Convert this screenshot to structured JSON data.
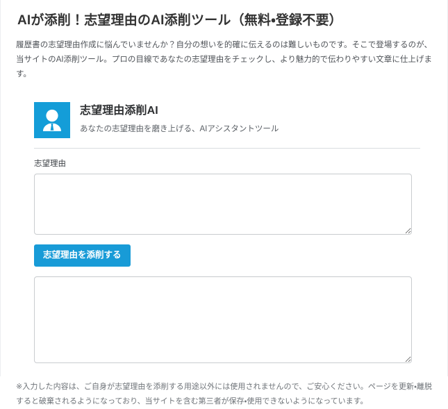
{
  "page": {
    "title": "AIが添削！志望理由のAI添削ツール（無料・登録不要）",
    "lead": "履歴書の志望理由作成に悩んでいませんか？自分の想いを的確に伝えるのは難しいものです。そこで登場するのが、当サイトのAI添削ツール。プロの目線であなたの志望理由をチェックし、より魅力的で伝わりやすい文章に仕上げます。"
  },
  "card": {
    "icon": "person-avatar-icon",
    "title": "志望理由添削AI",
    "subtitle": "あなたの志望理由を磨き上げる、AIアシスタントツール"
  },
  "form": {
    "input_label": "志望理由",
    "input_value": "",
    "input_placeholder": "",
    "submit_label": "志望理由を添削する",
    "output_value": "",
    "output_placeholder": ""
  },
  "footer": {
    "note": "※入力した内容は、ご自身が志望理由を添削する用途以外には使用されませんので、ご安心ください。ページを更新・離脱すると破棄されるようになっており、当サイトを含む第三者が保存・使用できないようになっています。"
  },
  "colors": {
    "accent": "#149dd8",
    "button": "#189bd7",
    "text": "#333333",
    "muted": "#6e7378",
    "border": "#c9cccf",
    "divider": "#d9dcdf"
  }
}
